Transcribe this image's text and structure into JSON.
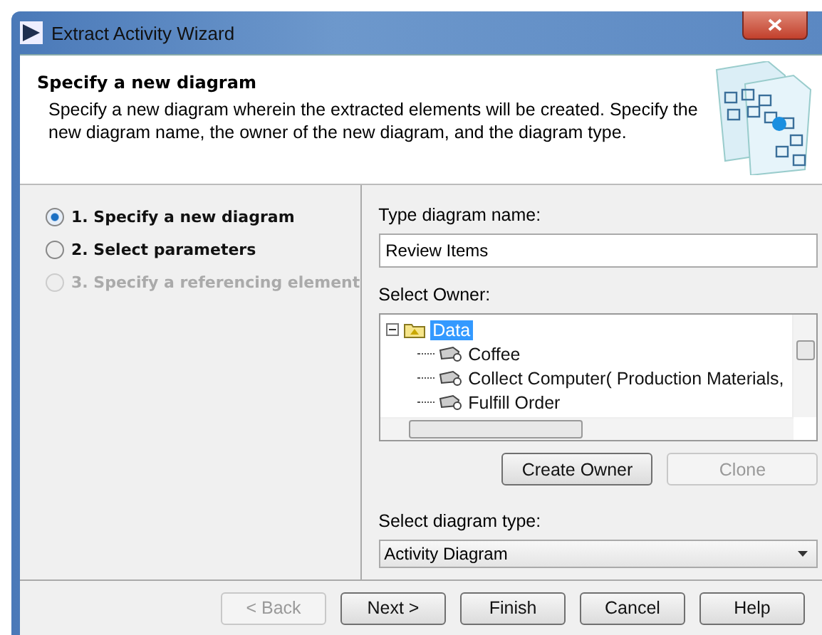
{
  "window": {
    "title": "Extract Activity Wizard"
  },
  "header": {
    "title": "Specify a new diagram",
    "description": "Specify a new diagram wherein the extracted elements will be created. Specify the new diagram name, the owner of the new diagram, and the diagram type."
  },
  "steps": [
    {
      "label": "1. Specify a new diagram",
      "selected": true,
      "disabled": false
    },
    {
      "label": "2. Select parameters",
      "selected": false,
      "disabled": false
    },
    {
      "label": "3. Specify a referencing element",
      "selected": false,
      "disabled": true
    }
  ],
  "name_field": {
    "label": "Type diagram name:",
    "value": "Review Items"
  },
  "owner": {
    "label": "Select Owner:",
    "tree": [
      {
        "label": "Data",
        "selected": true,
        "expanded": true,
        "children": [
          {
            "label": "Coffee",
            "selected": false
          },
          {
            "label": "Collect Computer( Production Materials,",
            "selected": false
          },
          {
            "label": "Fulfill Order",
            "selected": false
          }
        ]
      }
    ],
    "buttons": [
      {
        "label": "Create Owner",
        "disabled": false
      },
      {
        "label": "Clone",
        "disabled": true
      }
    ]
  },
  "type_field": {
    "label": "Select diagram type:",
    "value": "Activity Diagram"
  },
  "footer_buttons": [
    {
      "label": "< Back",
      "disabled": true
    },
    {
      "label": "Next >",
      "disabled": false
    },
    {
      "label": "Finish",
      "disabled": false
    },
    {
      "label": "Cancel",
      "disabled": false
    },
    {
      "label": "Help",
      "disabled": false
    }
  ]
}
